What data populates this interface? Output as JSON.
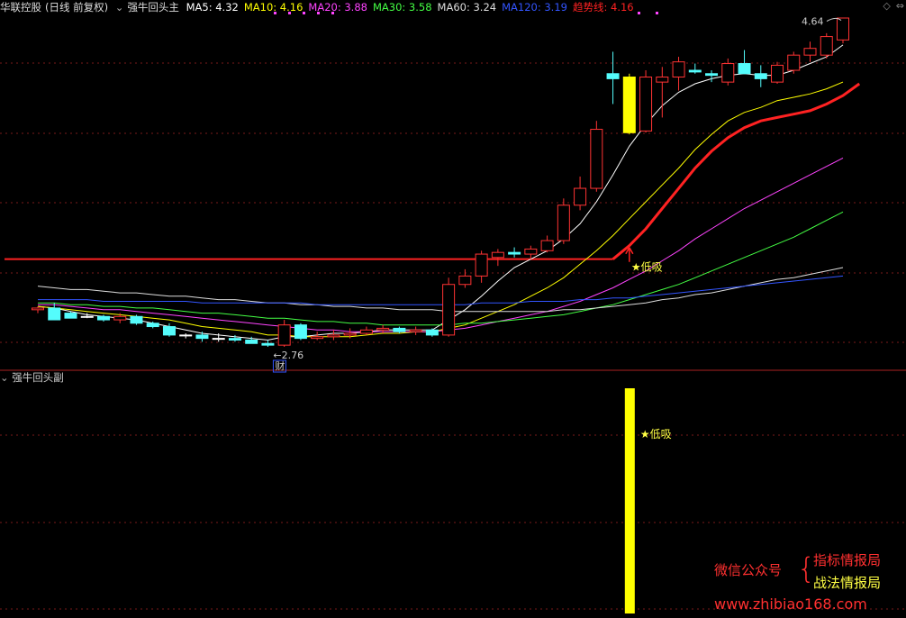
{
  "header": {
    "stock_name": "华联控股",
    "mode": "(日线 前复权)",
    "indicator": "强牛回头主",
    "ma": [
      {
        "label": "MA5:",
        "value": "4.32",
        "color": "#ffffff"
      },
      {
        "label": "MA10:",
        "value": "4.16",
        "color": "#ffff00"
      },
      {
        "label": "MA20:",
        "value": "3.88",
        "color": "#ff44ff"
      },
      {
        "label": "MA30:",
        "value": "3.58",
        "color": "#44ff44"
      },
      {
        "label": "MA60:",
        "value": "3.24",
        "color": "#dddddd"
      },
      {
        "label": "MA120:",
        "value": "3.19",
        "color": "#3355ff"
      },
      {
        "label": "趋势线:",
        "value": "4.16",
        "color": "#ff2222"
      }
    ]
  },
  "controls": [
    "◇",
    "⇔"
  ],
  "subpanel": {
    "title": "强牛回头副",
    "label": "★低吸"
  },
  "watermark": {
    "wechat": "微信公众号",
    "brace": "{",
    "line1": "指标情报局",
    "line2": "战法情报局",
    "url": "www.zhibiao168.com"
  },
  "chart_data": {
    "type": "candlestick",
    "high_label": "4.64",
    "low_label": "2.76",
    "low_marker": "财",
    "signal_label": "★低吸",
    "trend_line_start": 3.28,
    "colors": {
      "up": "#ff3333",
      "down": "#54fcfc",
      "flat": "#ffffff",
      "signal": "#ffff00"
    },
    "candles": [
      [
        2.98,
        3.0,
        2.96,
        2.99
      ],
      [
        2.99,
        3.02,
        2.93,
        2.92
      ],
      [
        2.96,
        2.97,
        2.94,
        2.93
      ],
      [
        2.94,
        2.96,
        2.93,
        2.94
      ],
      [
        2.94,
        2.95,
        2.91,
        2.92
      ],
      [
        2.92,
        2.96,
        2.9,
        2.94
      ],
      [
        2.94,
        2.95,
        2.89,
        2.9
      ],
      [
        2.9,
        2.91,
        2.87,
        2.88
      ],
      [
        2.88,
        2.9,
        2.82,
        2.83
      ],
      [
        2.83,
        2.84,
        2.81,
        2.83
      ],
      [
        2.83,
        2.85,
        2.79,
        2.81
      ],
      [
        2.81,
        2.84,
        2.79,
        2.81
      ],
      [
        2.81,
        2.83,
        2.79,
        2.8
      ],
      [
        2.8,
        2.82,
        2.78,
        2.78
      ],
      [
        2.78,
        2.8,
        2.76,
        2.77
      ],
      [
        2.77,
        2.92,
        2.76,
        2.89
      ],
      [
        2.89,
        2.9,
        2.8,
        2.81
      ],
      [
        2.81,
        2.85,
        2.8,
        2.82
      ],
      [
        2.82,
        2.86,
        2.8,
        2.83
      ],
      [
        2.83,
        2.87,
        2.81,
        2.84
      ],
      [
        2.84,
        2.88,
        2.83,
        2.86
      ],
      [
        2.86,
        2.89,
        2.84,
        2.87
      ],
      [
        2.87,
        2.88,
        2.84,
        2.85
      ],
      [
        2.85,
        2.88,
        2.83,
        2.86
      ],
      [
        2.86,
        2.87,
        2.82,
        2.83
      ],
      [
        2.83,
        3.17,
        2.82,
        3.13
      ],
      [
        3.13,
        3.22,
        3.11,
        3.18
      ],
      [
        3.18,
        3.33,
        3.14,
        3.31
      ],
      [
        3.29,
        3.34,
        3.24,
        3.32
      ],
      [
        3.32,
        3.35,
        3.29,
        3.31
      ],
      [
        3.31,
        3.36,
        3.28,
        3.34
      ],
      [
        3.33,
        3.42,
        3.32,
        3.39
      ],
      [
        3.39,
        3.64,
        3.37,
        3.6
      ],
      [
        3.6,
        3.77,
        3.57,
        3.7
      ],
      [
        3.7,
        4.1,
        3.68,
        4.05
      ],
      [
        4.38,
        4.51,
        4.2,
        4.35
      ],
      [
        4.36,
        4.38,
        4.02,
        4.03
      ],
      [
        4.04,
        4.4,
        4.03,
        4.36
      ],
      [
        4.33,
        4.42,
        4.12,
        4.36
      ],
      [
        4.36,
        4.48,
        4.28,
        4.45
      ],
      [
        4.4,
        4.44,
        4.38,
        4.39
      ],
      [
        4.38,
        4.4,
        4.33,
        4.37
      ],
      [
        4.33,
        4.47,
        4.31,
        4.44
      ],
      [
        4.44,
        4.52,
        4.4,
        4.38
      ],
      [
        4.38,
        4.43,
        4.3,
        4.35
      ],
      [
        4.33,
        4.45,
        4.32,
        4.43
      ],
      [
        4.4,
        4.51,
        4.38,
        4.49
      ],
      [
        4.49,
        4.57,
        4.45,
        4.53
      ],
      [
        4.49,
        4.62,
        4.47,
        4.6
      ],
      [
        4.58,
        4.68,
        4.56,
        4.71
      ]
    ],
    "ma_series": [
      {
        "name": "MA5",
        "color": "#ffffff",
        "values": [
          3.0,
          2.99,
          2.97,
          2.95,
          2.94,
          2.93,
          2.92,
          2.9,
          2.88,
          2.86,
          2.84,
          2.83,
          2.82,
          2.81,
          2.8,
          2.82,
          2.82,
          2.83,
          2.84,
          2.84,
          2.85,
          2.86,
          2.86,
          2.86,
          2.86,
          2.92,
          2.98,
          3.06,
          3.15,
          3.23,
          3.28,
          3.33,
          3.4,
          3.49,
          3.62,
          3.78,
          3.95,
          4.08,
          4.19,
          4.27,
          4.32,
          4.35,
          4.37,
          4.38,
          4.37,
          4.37,
          4.4,
          4.44,
          4.48,
          4.55
        ]
      },
      {
        "name": "MA10",
        "color": "#ffff00",
        "values": [
          3.0,
          2.99,
          2.98,
          2.97,
          2.96,
          2.95,
          2.94,
          2.93,
          2.92,
          2.9,
          2.88,
          2.87,
          2.86,
          2.85,
          2.83,
          2.83,
          2.82,
          2.82,
          2.82,
          2.82,
          2.83,
          2.84,
          2.84,
          2.85,
          2.85,
          2.87,
          2.89,
          2.93,
          2.97,
          3.01,
          3.06,
          3.11,
          3.17,
          3.25,
          3.33,
          3.42,
          3.52,
          3.62,
          3.72,
          3.82,
          3.93,
          4.02,
          4.1,
          4.15,
          4.18,
          4.22,
          4.24,
          4.26,
          4.29,
          4.33
        ]
      },
      {
        "name": "MA20",
        "color": "#ff44ff",
        "values": [
          3.01,
          3.01,
          3.0,
          2.99,
          2.98,
          2.98,
          2.97,
          2.96,
          2.95,
          2.94,
          2.93,
          2.92,
          2.91,
          2.9,
          2.89,
          2.88,
          2.87,
          2.86,
          2.86,
          2.85,
          2.85,
          2.85,
          2.85,
          2.85,
          2.85,
          2.86,
          2.87,
          2.89,
          2.91,
          2.93,
          2.95,
          2.97,
          3.0,
          3.03,
          3.07,
          3.11,
          3.16,
          3.21,
          3.27,
          3.33,
          3.4,
          3.46,
          3.52,
          3.58,
          3.63,
          3.68,
          3.73,
          3.78,
          3.83,
          3.88
        ]
      },
      {
        "name": "MA30",
        "color": "#44ff44",
        "values": [
          3.02,
          3.02,
          3.01,
          3.01,
          3.0,
          3.0,
          2.99,
          2.99,
          2.98,
          2.97,
          2.96,
          2.96,
          2.95,
          2.94,
          2.93,
          2.93,
          2.92,
          2.91,
          2.91,
          2.9,
          2.9,
          2.89,
          2.89,
          2.89,
          2.89,
          2.89,
          2.9,
          2.9,
          2.91,
          2.92,
          2.93,
          2.94,
          2.95,
          2.97,
          2.99,
          3.01,
          3.04,
          3.07,
          3.1,
          3.13,
          3.17,
          3.21,
          3.25,
          3.29,
          3.33,
          3.37,
          3.41,
          3.46,
          3.51,
          3.56
        ]
      },
      {
        "name": "MA60",
        "color": "#dddddd",
        "values": [
          3.12,
          3.11,
          3.1,
          3.1,
          3.09,
          3.08,
          3.08,
          3.07,
          3.06,
          3.06,
          3.05,
          3.04,
          3.04,
          3.03,
          3.02,
          3.02,
          3.01,
          3.01,
          3.0,
          3.0,
          2.99,
          2.99,
          2.98,
          2.98,
          2.98,
          2.97,
          2.97,
          2.97,
          2.97,
          2.97,
          2.97,
          2.97,
          2.98,
          2.98,
          2.99,
          3.0,
          3.01,
          3.02,
          3.04,
          3.05,
          3.07,
          3.08,
          3.1,
          3.12,
          3.14,
          3.16,
          3.17,
          3.19,
          3.21,
          3.23
        ]
      },
      {
        "name": "MA120",
        "color": "#3355ff",
        "values": [
          3.04,
          3.04,
          3.04,
          3.04,
          3.03,
          3.03,
          3.03,
          3.03,
          3.03,
          3.03,
          3.02,
          3.02,
          3.02,
          3.02,
          3.02,
          3.02,
          3.02,
          3.01,
          3.01,
          3.01,
          3.01,
          3.01,
          3.01,
          3.01,
          3.01,
          3.01,
          3.01,
          3.02,
          3.02,
          3.02,
          3.03,
          3.03,
          3.03,
          3.04,
          3.04,
          3.05,
          3.05,
          3.06,
          3.07,
          3.08,
          3.09,
          3.1,
          3.11,
          3.12,
          3.13,
          3.14,
          3.15,
          3.16,
          3.17,
          3.18
        ]
      }
    ],
    "trend_series": {
      "name": "趋势线",
      "color": "#ff2222",
      "start_index": 35,
      "values": [
        3.28,
        3.36,
        3.46,
        3.58,
        3.7,
        3.82,
        3.92,
        4.0,
        4.06,
        4.1,
        4.12,
        4.14,
        4.16,
        4.2,
        4.25,
        4.32
      ]
    },
    "signal_index": 36
  }
}
